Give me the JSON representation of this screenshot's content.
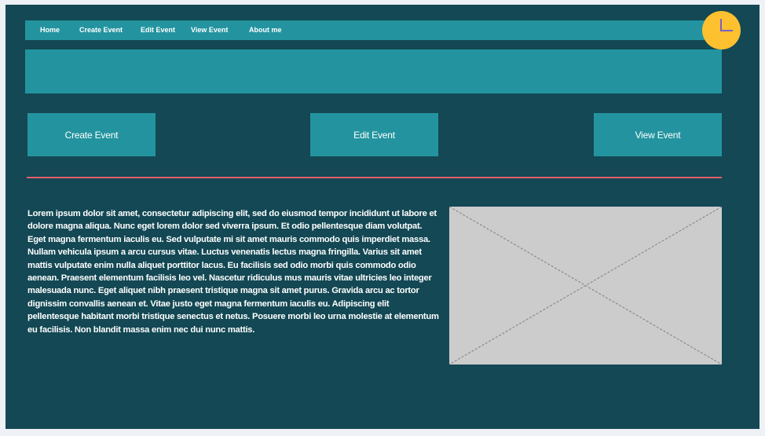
{
  "nav": {
    "items": [
      {
        "label": "Home"
      },
      {
        "label": "Create Event"
      },
      {
        "label": "Edit Event"
      },
      {
        "label": "View Event"
      },
      {
        "label": "About me"
      }
    ]
  },
  "actions": {
    "create_label": "Create Event",
    "edit_label": "Edit Event",
    "view_label": "View Event"
  },
  "content": {
    "paragraph": "Lorem ipsum dolor sit amet, consectetur adipiscing elit, sed do eiusmod tempor incididunt ut labore et dolore magna aliqua. Nunc eget lorem dolor sed viverra ipsum. Et odio pellentesque diam volutpat. Eget magna fermentum iaculis eu. Sed vulputate mi sit amet mauris commodo quis imperdiet massa. Nullam vehicula ipsum a arcu cursus vitae. Luctus venenatis lectus magna fringilla. Varius sit amet mattis vulputate enim nulla aliquet porttitor lacus. Eu facilisis sed odio morbi quis commodo odio aenean. Praesent elementum facilisis leo vel. Nascetur ridiculus mus mauris vitae ultricies leo integer malesuada nunc. Eget aliquet nibh praesent tristique magna sit amet purus. Gravida arcu ac tortor dignissim convallis aenean et. Vitae justo eget magna fermentum iaculis eu. Adipiscing elit pellentesque habitant morbi tristique senectus et netus. Posuere morbi leo urna molestie at elementum eu facilisis. Non blandit massa enim nec dui nunc mattis."
  },
  "icons": {
    "clock": "clock-icon",
    "image_placeholder": "image-placeholder-icon"
  },
  "colors": {
    "background": "#134854",
    "accent": "#23949f",
    "divider": "#e0606b",
    "clock": "#fdc02f",
    "clock_hands": "#7b5fc7",
    "placeholder": "#cccccc"
  }
}
